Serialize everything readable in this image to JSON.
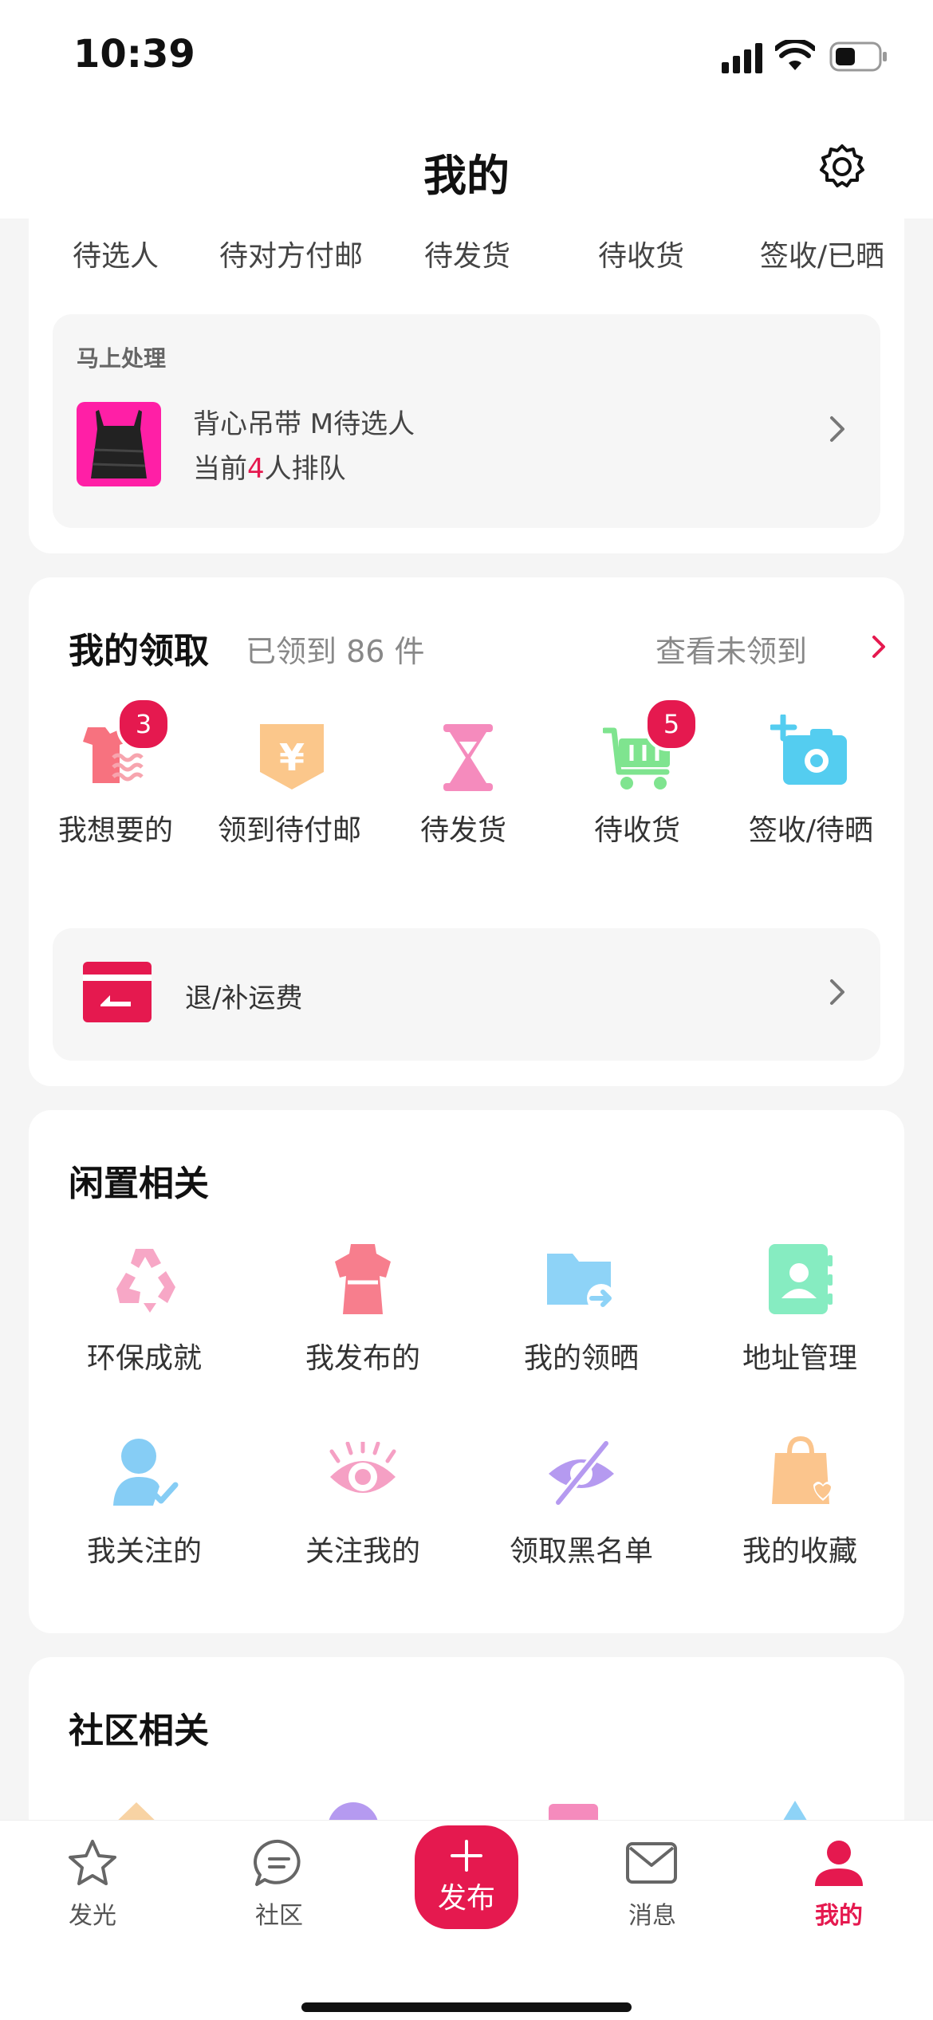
{
  "status": {
    "time": "10:39"
  },
  "header": {
    "title": "我的"
  },
  "order_tabs": [
    "待选人",
    "待对方付邮",
    "待发货",
    "待收货",
    "签收/已晒"
  ],
  "urgent": {
    "title": "马上处理",
    "item_name": "背心吊带 M待选人",
    "queue_prefix": "当前",
    "queue_count": "4",
    "queue_suffix": "人排队"
  },
  "claims": {
    "title": "我的领取",
    "count_text": "已领到 86 件",
    "view_unclaimed": "查看未领到",
    "items": [
      {
        "label": "我想要的",
        "badge": "3",
        "icon": "shirt-wave-icon"
      },
      {
        "label": "领到待付邮",
        "badge": "",
        "icon": "yen-shield-icon"
      },
      {
        "label": "待发货",
        "badge": "",
        "icon": "hourglass-icon"
      },
      {
        "label": "待收货",
        "badge": "5",
        "icon": "cart-icon"
      },
      {
        "label": "签收/待晒",
        "badge": "",
        "icon": "camera-add-icon"
      }
    ],
    "refund_label": "退/补运费"
  },
  "idle": {
    "title": "闲置相关",
    "items": [
      {
        "label": "环保成就",
        "icon": "recycle-icon"
      },
      {
        "label": "我发布的",
        "icon": "dress-icon"
      },
      {
        "label": "我的领晒",
        "icon": "folder-share-icon"
      },
      {
        "label": "地址管理",
        "icon": "address-book-icon"
      },
      {
        "label": "我关注的",
        "icon": "user-check-icon"
      },
      {
        "label": "关注我的",
        "icon": "eye-icon"
      },
      {
        "label": "领取黑名单",
        "icon": "eye-off-icon"
      },
      {
        "label": "我的收藏",
        "icon": "bag-heart-icon"
      }
    ]
  },
  "community": {
    "title": "社区相关"
  },
  "tabs": [
    {
      "label": "发光",
      "icon": "star-icon"
    },
    {
      "label": "社区",
      "icon": "chat-icon"
    },
    {
      "label": "发布",
      "icon": "plus-icon"
    },
    {
      "label": "消息",
      "icon": "mail-icon"
    },
    {
      "label": "我的",
      "icon": "person-icon"
    }
  ],
  "colors": {
    "accent": "#e5194f",
    "pink": "#f59ab8",
    "blue": "#8dd3f5",
    "green": "#8ef0c4",
    "orange": "#f8c58e",
    "purple": "#b59af0"
  }
}
